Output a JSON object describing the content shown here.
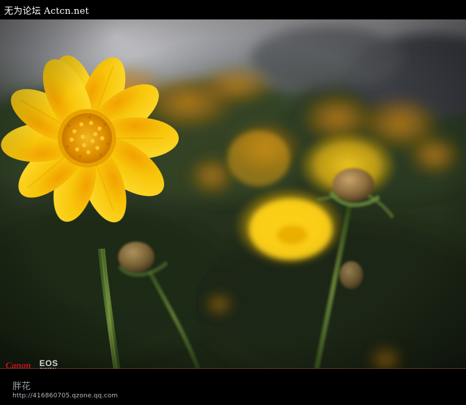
{
  "banner": {
    "title": "无为论坛 Actcn.net"
  },
  "photo": {
    "subject": "yellow coreopsis flower with blurred flower field background",
    "primary_colors": {
      "petal_yellow": "#f8d10f",
      "petal_shadow": "#e29d00",
      "center_orange": "#e39a00",
      "green_background": "#223119"
    }
  },
  "brand": {
    "canon": "Canon",
    "eos": "EOS",
    "eos_sub": "DIGITAL"
  },
  "caption": {
    "title": "胖花",
    "url": "http://416860705.qzone.qq.com"
  }
}
